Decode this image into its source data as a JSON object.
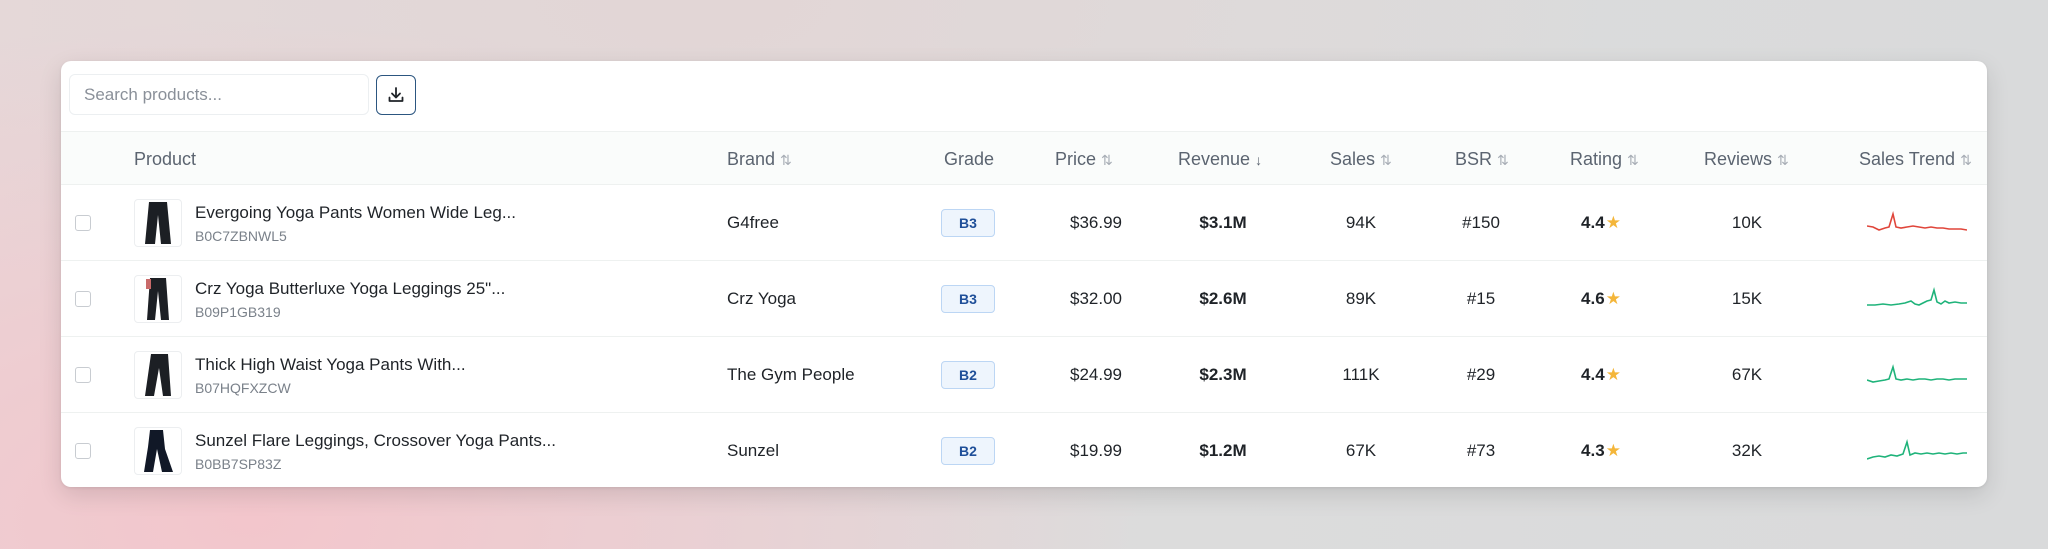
{
  "search": {
    "placeholder": "Search products..."
  },
  "columns": {
    "product": "Product",
    "brand": "Brand",
    "grade": "Grade",
    "price": "Price",
    "revenue": "Revenue",
    "sales": "Sales",
    "bsr": "BSR",
    "rating": "Rating",
    "reviews": "Reviews",
    "trend": "Sales Trend"
  },
  "sort_icons": {
    "inactive": "⇅",
    "active": "↓"
  },
  "star_glyph": "★",
  "rows": [
    {
      "name": "Evergoing Yoga Pants Women Wide Leg...",
      "asin": "B0C7ZBNWL5",
      "brand": "G4free",
      "grade": "B3",
      "price": "$36.99",
      "revenue": "$3.1M",
      "sales": "94K",
      "bsr": "#150",
      "rating": "4.4",
      "reviews": "10K",
      "trend_color": "#e0453a"
    },
    {
      "name": "Crz Yoga Butterluxe Yoga Leggings 25\"...",
      "asin": "B09P1GB319",
      "brand": "Crz Yoga",
      "grade": "B3",
      "price": "$32.00",
      "revenue": "$2.6M",
      "sales": "89K",
      "bsr": "#15",
      "rating": "4.6",
      "reviews": "15K",
      "trend_color": "#1fb37a"
    },
    {
      "name": "Thick High Waist Yoga Pants With...",
      "asin": "B07HQFXZCW",
      "brand": "The Gym People",
      "grade": "B2",
      "price": "$24.99",
      "revenue": "$2.3M",
      "sales": "111K",
      "bsr": "#29",
      "rating": "4.4",
      "reviews": "67K",
      "trend_color": "#1fb37a"
    },
    {
      "name": "Sunzel Flare Leggings, Crossover Yoga Pants...",
      "asin": "B0BB7SP83Z",
      "brand": "Sunzel",
      "grade": "B2",
      "price": "$19.99",
      "revenue": "$1.2M",
      "sales": "67K",
      "bsr": "#73",
      "rating": "4.3",
      "reviews": "32K",
      "trend_color": "#1fb37a"
    }
  ],
  "colors": {
    "accent": "#2c5680",
    "grade_text": "#1f4f99",
    "star": "#f4b63a",
    "trend_down": "#e0453a",
    "trend_up": "#1fb37a"
  }
}
